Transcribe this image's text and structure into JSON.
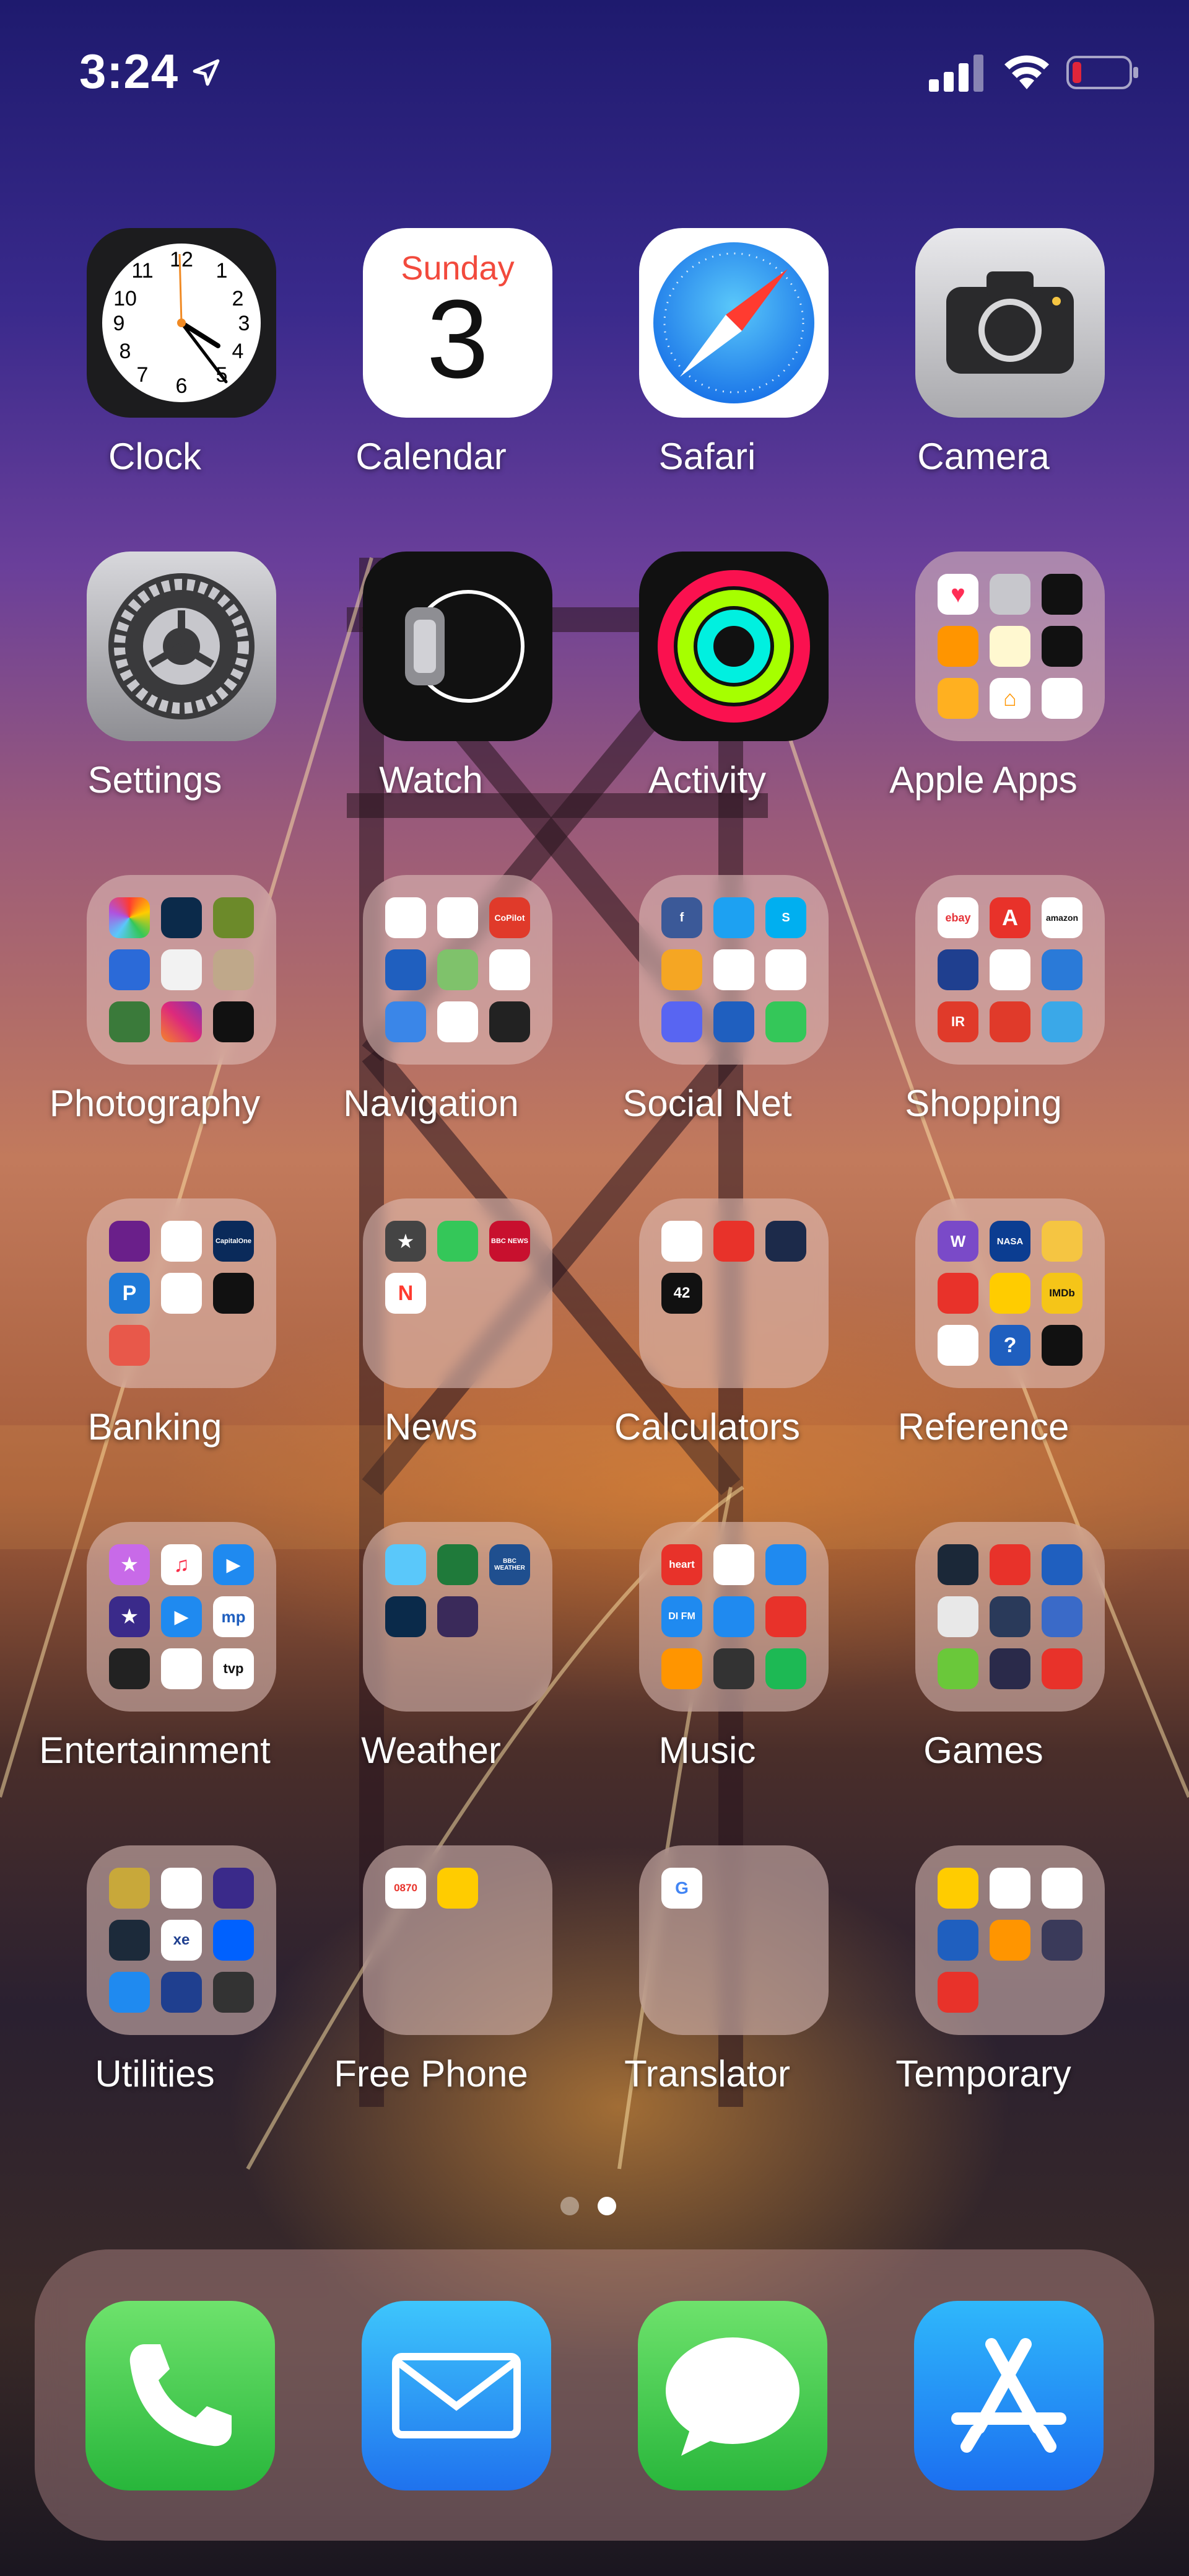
{
  "status_bar": {
    "time": "3:24",
    "icons": [
      "location-arrow-icon",
      "signal-icon",
      "wifi-icon",
      "battery-low-icon"
    ],
    "battery_color": "#e0253a"
  },
  "home_apps": [
    {
      "name": "Clock",
      "type": "app"
    },
    {
      "name": "Calendar",
      "type": "app",
      "weekday": "Sunday",
      "day": "3"
    },
    {
      "name": "Safari",
      "type": "app"
    },
    {
      "name": "Camera",
      "type": "app"
    },
    {
      "name": "Settings",
      "type": "app"
    },
    {
      "name": "Watch",
      "type": "app"
    },
    {
      "name": "Activity",
      "type": "app"
    },
    {
      "name": "Apple Apps",
      "type": "folder"
    },
    {
      "name": "Photography",
      "type": "folder"
    },
    {
      "name": "Navigation",
      "type": "folder"
    },
    {
      "name": "Social Net",
      "type": "folder"
    },
    {
      "name": "Shopping",
      "type": "folder"
    },
    {
      "name": "Banking",
      "type": "folder"
    },
    {
      "name": "News",
      "type": "folder"
    },
    {
      "name": "Calculators",
      "type": "folder"
    },
    {
      "name": "Reference",
      "type": "folder"
    },
    {
      "name": "Entertainment",
      "type": "folder"
    },
    {
      "name": "Weather",
      "type": "folder"
    },
    {
      "name": "Music",
      "type": "folder"
    },
    {
      "name": "Games",
      "type": "folder"
    },
    {
      "name": "Utilities",
      "type": "folder"
    },
    {
      "name": "Free Phone",
      "type": "folder"
    },
    {
      "name": "Translator",
      "type": "folder"
    },
    {
      "name": "Temporary",
      "type": "folder"
    }
  ],
  "folder_mini_labels": {
    "shopping": [
      "ebay",
      "A",
      "amazon",
      "",
      "",
      "",
      "IR",
      "",
      ""
    ],
    "navigation": [
      "",
      "",
      "CoPilot"
    ],
    "news": [
      "★",
      "",
      "BBC NEWS",
      ""
    ],
    "calculators": [
      "",
      "",
      "",
      "42"
    ],
    "reference": [
      "W",
      "NASA",
      "",
      "",
      "",
      "IMDb",
      "",
      "?",
      ""
    ],
    "entertainment": [
      "★",
      "♫",
      "▶",
      "★",
      "▶",
      "mp",
      "",
      "",
      "tvp"
    ],
    "weather": [
      "",
      "",
      "BBC WEATHER",
      "",
      ""
    ],
    "music": [
      "heart",
      "",
      "",
      "DI FM",
      "",
      "",
      "",
      "",
      ""
    ],
    "utilities": [
      "",
      "",
      "",
      "",
      "xe",
      "",
      "",
      "",
      ""
    ],
    "free_phone": [
      "0870",
      ""
    ],
    "banking": [
      "",
      "",
      "CapitalOne",
      "P",
      "",
      "",
      ""
    ]
  },
  "page_dots": {
    "count": 2,
    "active_index": 1
  },
  "dock": [
    "Phone",
    "Mail",
    "Messages",
    "App Store"
  ],
  "colors": {
    "label": "#ffffff",
    "folder_bg": "rgba(225,195,190,0.55)",
    "dock_bg": "rgba(220,170,170,0.35)"
  }
}
